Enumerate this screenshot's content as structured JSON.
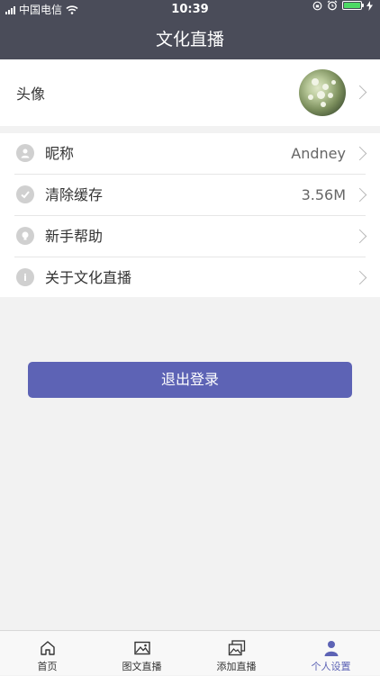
{
  "status_bar": {
    "carrier": "中国电信",
    "time": "10:39",
    "battery_level": 1.0
  },
  "header": {
    "title": "文化直播"
  },
  "profile": {
    "avatar_label": "头像"
  },
  "settings": [
    {
      "label": "昵称",
      "value": "Andney",
      "icon": "user-icon"
    },
    {
      "label": "清除缓存",
      "value": "3.56M",
      "icon": "check-icon"
    },
    {
      "label": "新手帮助",
      "value": "",
      "icon": "bulb-icon"
    },
    {
      "label": "关于文化直播",
      "value": "",
      "icon": "info-icon"
    }
  ],
  "logout": {
    "label": "退出登录"
  },
  "tabbar": {
    "items": [
      {
        "label": "首页",
        "icon": "home-icon"
      },
      {
        "label": "图文直播",
        "icon": "image-icon"
      },
      {
        "label": "添加直播",
        "icon": "add-images-icon"
      },
      {
        "label": "个人设置",
        "icon": "person-icon"
      }
    ],
    "active_index": 3
  },
  "colors": {
    "header_bg": "#4a4c59",
    "accent": "#5d63b5",
    "page_bg": "#f2f2f2"
  }
}
